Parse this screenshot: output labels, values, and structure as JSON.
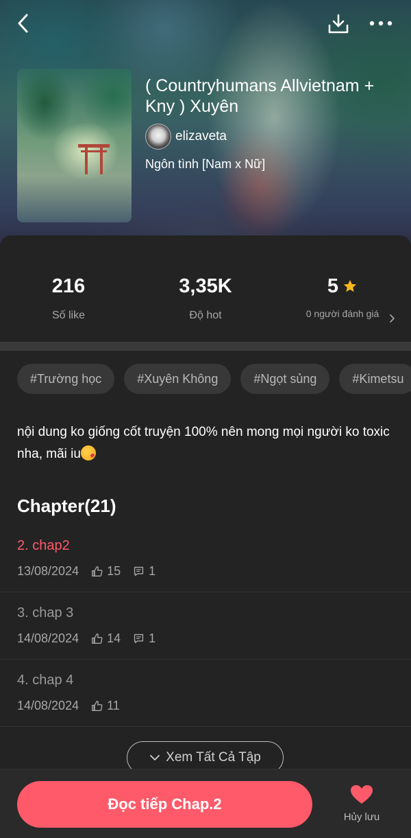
{
  "header": {
    "title": "( Countryhumans Allvietnam + Kny ) Xuyên",
    "author": "elizaveta",
    "genre": "Ngôn tình [Nam x Nữ]"
  },
  "stats": {
    "likes_value": "216",
    "likes_label": "Số like",
    "hot_value": "3,35K",
    "hot_label": "Độ hot",
    "rating_value": "5",
    "rating_label": "0 người đánh giá"
  },
  "tags": [
    "#Trường học",
    "#Xuyên Không",
    "#Ngọt sủng",
    "#Kimetsu"
  ],
  "description": "nội dung ko giống cốt truyện 100% nên mong mọi người ko toxic nha, mãi iu",
  "chapters": {
    "heading": "Chapter(21)",
    "items": [
      {
        "title": "2. chap2",
        "date": "13/08/2024",
        "likes": "15",
        "comments": "1"
      },
      {
        "title": "3. chap 3",
        "date": "14/08/2024",
        "likes": "14",
        "comments": "1"
      },
      {
        "title": "4. chap 4",
        "date": "14/08/2024",
        "likes": "11"
      }
    ],
    "view_all_label": "Xem Tất Cả Tập"
  },
  "bottom": {
    "continue_label": "Đọc tiếp Chap.2",
    "save_label": "Hủy lưu"
  },
  "colors": {
    "accent": "#ff5a6a",
    "star": "#f5b81c",
    "background": "#232323"
  },
  "icons": [
    "back-arrow-icon",
    "download-icon",
    "more-icon",
    "star-icon",
    "chevron-right-icon",
    "thumbs-up-icon",
    "comment-icon",
    "chevron-down-icon",
    "heart-icon"
  ]
}
